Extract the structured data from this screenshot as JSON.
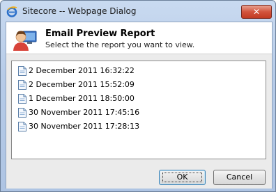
{
  "window": {
    "title": "Sitecore -- Webpage Dialog",
    "app_icon": "ie-icon",
    "close_label": "✕"
  },
  "header": {
    "title": "Email Preview Report",
    "subtitle": "Select the the report you want to view.",
    "icon": "user-computer-icon"
  },
  "reports": [
    {
      "label": "2 December 2011 16:32:22"
    },
    {
      "label": "2 December 2011 15:52:09"
    },
    {
      "label": "1 December 2011 18:50:00"
    },
    {
      "label": "30 November 2011 17:45:16"
    },
    {
      "label": "30 November 2011 17:28:13"
    }
  ],
  "buttons": {
    "ok_label": "OK",
    "cancel_label": "Cancel"
  },
  "colors": {
    "titlebar": "#b6cbe8",
    "close_button": "#c23b22",
    "panel": "#ebebeb"
  }
}
